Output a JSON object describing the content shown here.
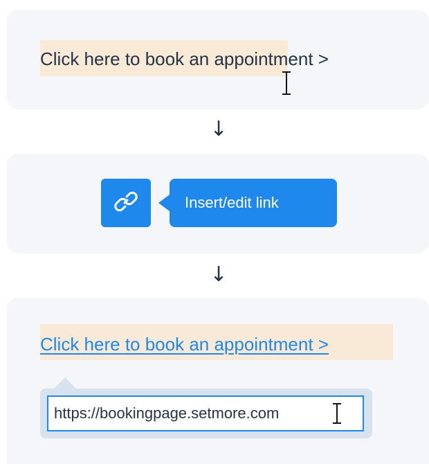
{
  "step1": {
    "text": "Click here to book an appointment >",
    "cursor_icon": "text-cursor-icon"
  },
  "arrows": [
    "↓",
    "↓"
  ],
  "step2": {
    "link_icon": "link-icon",
    "tooltip_label": "Insert/edit link",
    "accent_color": "#1e88ec"
  },
  "step3": {
    "link_text": "Click here to book an appointment >",
    "url_value": "https://bookingpage.setmore.com",
    "cursor_icon": "text-cursor-icon"
  },
  "colors": {
    "panel_bg": "#f4f6fa",
    "highlight": "#f8ead6",
    "text": "#243447",
    "link": "#1e88ec",
    "popover_bg": "#d8e1ee"
  }
}
